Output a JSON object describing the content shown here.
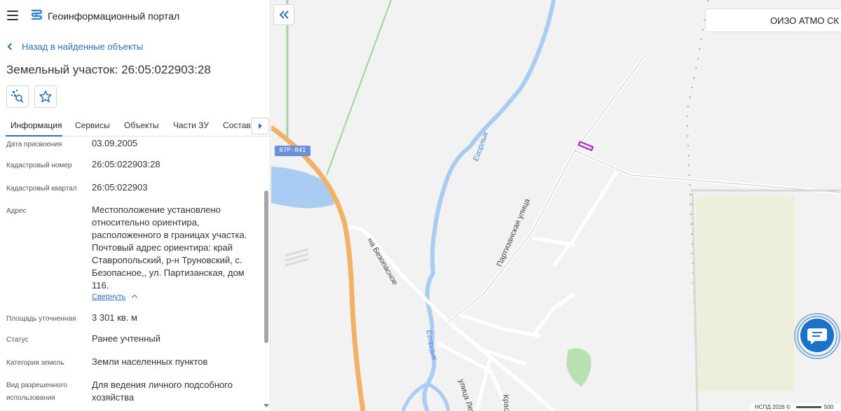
{
  "app": {
    "title": "Геоинформационный портал"
  },
  "nav": {
    "back_label": "Назад в найденные объекты"
  },
  "object": {
    "title": "Земельный участок: 26:05:022903:28"
  },
  "tabs": [
    {
      "label": "Информация"
    },
    {
      "label": "Сервисы"
    },
    {
      "label": "Объекты"
    },
    {
      "label": "Части ЗУ"
    },
    {
      "label": "Состав"
    }
  ],
  "fields": [
    {
      "label": "Дата присвоения",
      "value": "03.09.2005"
    },
    {
      "label": "Кадастровый номер",
      "value": "26:05:022903:28"
    },
    {
      "label": "Кадастровый квартал",
      "value": "26:05:022903"
    },
    {
      "label": "Адрес",
      "value": "Местоположение установлено относительно ориентира, расположенного в границах участка. Почтовый адрес ориентира: край Ставропольский, р-н Труновский, с. Безопасное,, ул. Партизанская, дом 116."
    },
    {
      "label": "Площадь уточненная",
      "value": "3 301 кв. м"
    },
    {
      "label": "Статус",
      "value": "Ранее учтенный"
    },
    {
      "label": "Категория земель",
      "value": "Земли населенных пунктов"
    },
    {
      "label": "Вид разрешенного использования",
      "value": "Для ведения личного подсобного хозяйства"
    }
  ],
  "address_collapse_label": "Свернуть",
  "map": {
    "org_label": "ОИЗО АТМО СК",
    "road_badge": "07Р-041",
    "labels": {
      "road_bezopasnoe": "на Безопасное",
      "street_partizanskaya": "Партизанская улица",
      "street_len": "улица Лен",
      "street_kras": "Крас",
      "river_1": "Егорлык",
      "river_2": "Егорлык"
    },
    "attribution": "НСПД 2026 ©",
    "scale": "500"
  },
  "icons": {
    "menu": "hamburger-icon",
    "logo": "portal-logo-icon",
    "back": "chevron-left-icon",
    "search_on_map": "map-search-icon",
    "favorite": "star-icon",
    "tabs_next": "arrow-right-icon",
    "collapse_up": "chevron-up-icon",
    "panel_collapse": "double-chevron-left-icon",
    "chat": "chat-bubble-icon"
  },
  "colors": {
    "accent": "#2f6fb3",
    "chat": "#1a73c8",
    "water": "#a9cdf2",
    "main_road": "#f2b266",
    "park": "#b9dfb3",
    "field": "#eeeedc",
    "plot_outline": "#a020c0"
  }
}
